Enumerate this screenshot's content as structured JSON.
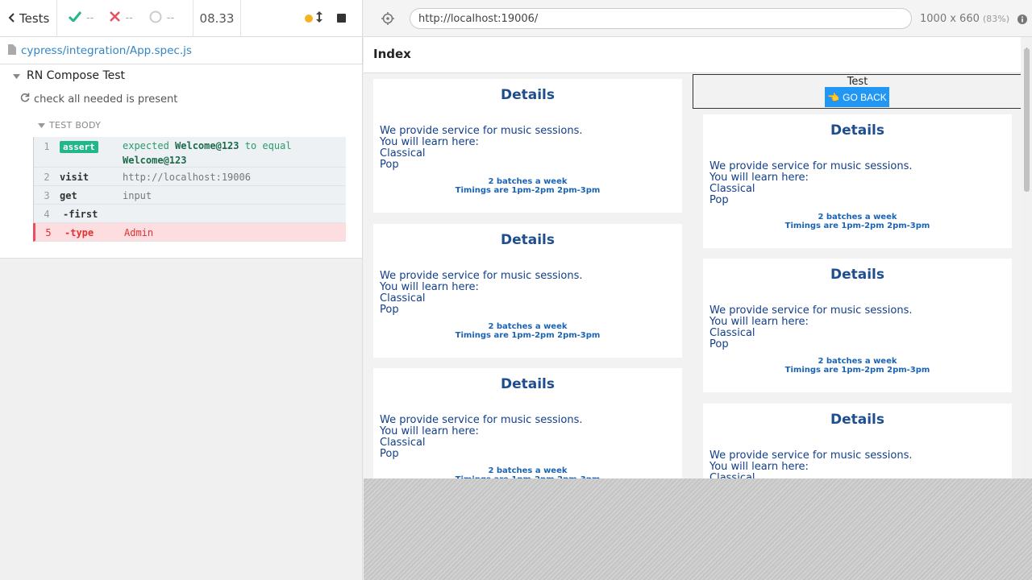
{
  "reporter": {
    "tests_label": "Tests",
    "passed": "--",
    "failed": "--",
    "pending": "--",
    "duration": "08.33",
    "spec_path": "cypress/integration/App.spec.js",
    "suite_title": "RN Compose Test",
    "test_title": "check all needed is present",
    "test_body_label": "TEST BODY",
    "commands": [
      {
        "num": "1",
        "name": "assert",
        "msg_expected": "expected",
        "msg_value": "Welcome@123",
        "msg_to_equal": "to equal",
        "msg_value2": "Welcome@123"
      },
      {
        "num": "2",
        "name": "visit",
        "msg": "http://localhost:19006"
      },
      {
        "num": "3",
        "name": "get",
        "msg": "input"
      },
      {
        "num": "4",
        "name": "-first",
        "msg": ""
      },
      {
        "num": "5",
        "name": "-type",
        "msg": "Admin"
      }
    ]
  },
  "aut": {
    "url": "http://localhost:19006/",
    "viewport": "1000 x 660",
    "scale": "(83%)",
    "app_title": "Index",
    "test_label": "Test",
    "go_back_label": "GO BACK",
    "go_back_emoji": "👈",
    "card": {
      "title": "Details",
      "lines": [
        "We provide service for music sessions.",
        "You will learn here:",
        "Classical",
        "Pop"
      ],
      "note1": "2 batches a week",
      "note2": "Timings are 1pm-2pm 2pm-3pm"
    }
  },
  "colors": {
    "pass": "#22b68a",
    "fail": "#e94f5f",
    "link": "#3386c6",
    "button": "#2196f3",
    "card_title": "#1f4e8f"
  }
}
